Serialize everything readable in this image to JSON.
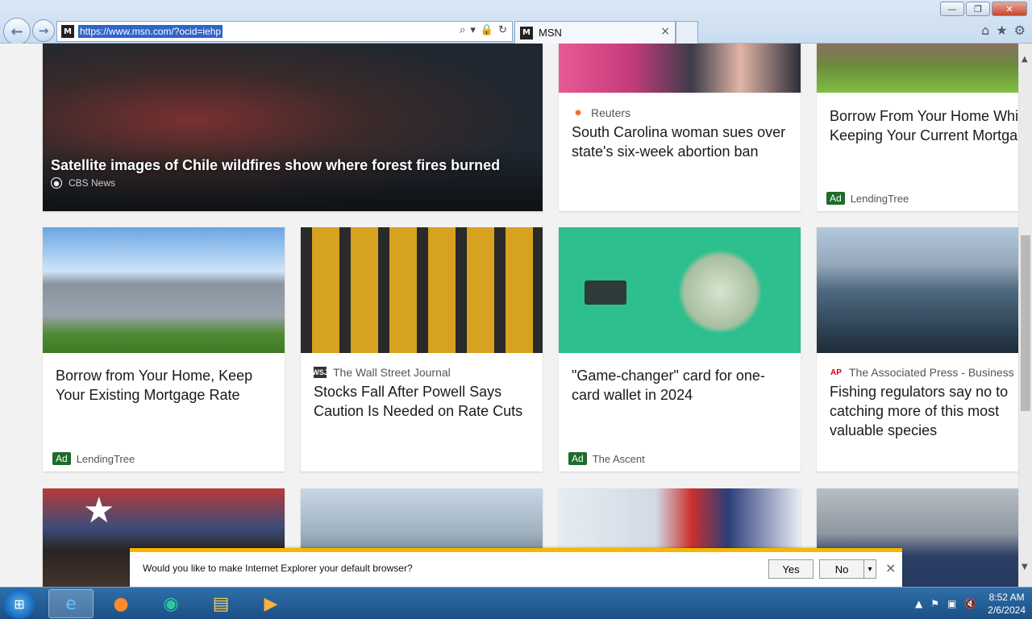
{
  "browser": {
    "url": "https://www.msn.com/?ocid=iehp",
    "tab_title": "MSN",
    "tab_close": "×",
    "window_buttons": {
      "minimize": "—",
      "maximize": "❐",
      "close": "✕"
    },
    "nav": {
      "back": "←",
      "forward": "→"
    },
    "address_icons": [
      "⌕",
      "▾",
      "🔒",
      "↻"
    ],
    "toolbar_icons": [
      "⌂",
      "★",
      "⚙"
    ]
  },
  "feed": {
    "cards": [
      {
        "headline": "Satellite images of Chile wildfires show where forest fires burned",
        "source": "CBS News"
      },
      {
        "source": "Reuters",
        "headline": "South Carolina woman sues over state's six-week abortion ban"
      },
      {
        "headline": "Borrow From Your Home While Keeping Your Current Mortgage Rate",
        "ad_label": "Ad",
        "advertiser": "LendingTree"
      },
      {
        "headline": "Borrow from Your Home, Keep Your Existing Mortgage Rate",
        "ad_label": "Ad",
        "advertiser": "LendingTree"
      },
      {
        "source": "The Wall Street Journal",
        "source_logo": "WSJ",
        "headline": "Stocks Fall After Powell Says Caution Is Needed on Rate Cuts"
      },
      {
        "headline": "\"Game-changer\" card for one-card wallet in 2024",
        "ad_label": "Ad",
        "advertiser": "The Ascent"
      },
      {
        "source": "The Associated Press - Business",
        "source_logo": "AP",
        "headline": "Fishing regulators say no to catching more of this most valuable species"
      }
    ]
  },
  "notification": {
    "message": "Would you like to make Internet Explorer your default browser?",
    "yes": "Yes",
    "no": "No",
    "dropdown": "▾",
    "close": "×"
  },
  "taskbar": {
    "start": "⊞",
    "apps": [
      "e",
      "●",
      "◉",
      "▤",
      "▶"
    ],
    "tray": [
      "▲",
      "⚑",
      "▣",
      "🔇"
    ],
    "time": "8:52 AM",
    "date": "2/6/2024"
  },
  "colors": {
    "ad_badge": "#1f6b2a",
    "notify_accent": "#f6b700",
    "url_highlight": "#3064c8"
  }
}
